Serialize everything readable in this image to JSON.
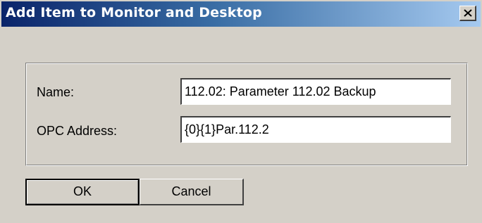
{
  "window": {
    "title": "Add Item to Monitor and Desktop",
    "close_icon": "close-icon"
  },
  "form": {
    "name_label": "Name:",
    "name_value": "112.02: Parameter 112.02 Backup",
    "opc_label": "OPC Address:",
    "opc_value": "{0}{1}Par.112.2"
  },
  "buttons": {
    "ok_label": "OK",
    "cancel_label": "Cancel"
  },
  "colors": {
    "titlebar_start": "#0a246a",
    "titlebar_end": "#a6caf0",
    "dialog_bg": "#d4d0c8"
  }
}
